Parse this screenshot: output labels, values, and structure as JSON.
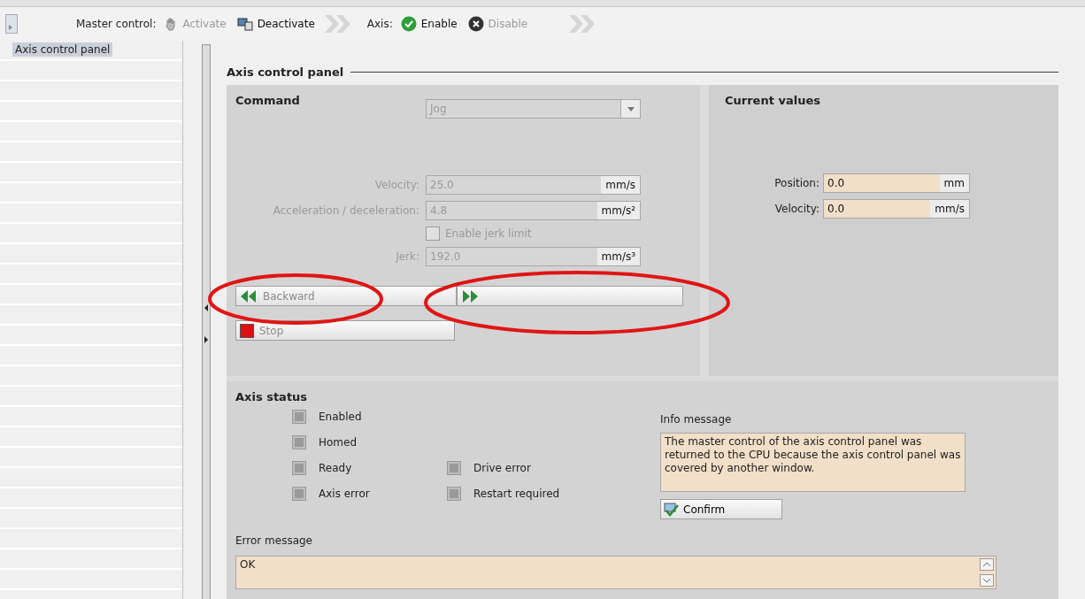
{
  "toolbar": {
    "master_control_label": "Master control:",
    "master_buttons": [
      {
        "kind": "activate",
        "label": "Activate",
        "disabled": true
      },
      {
        "kind": "deactivate",
        "label": "Deactivate",
        "disabled": false
      }
    ],
    "axis_label": "Axis:",
    "axis_buttons": [
      {
        "kind": "enable",
        "label": "Enable",
        "disabled": false
      },
      {
        "kind": "disable",
        "label": "Disable",
        "disabled": true
      }
    ]
  },
  "sidebar": {
    "items": [
      {
        "label": "Axis control panel",
        "selected": true
      }
    ]
  },
  "panel_title": "Axis control panel",
  "command": {
    "title": "Command",
    "disabled": true,
    "mode": "Jog",
    "rows": [
      {
        "kind": "field",
        "label": "Velocity:",
        "value": "25.0",
        "unit": "mm/s"
      },
      {
        "kind": "field",
        "label": "Acceleration / deceleration:",
        "value": "4.8",
        "unit": "mm/s²"
      },
      {
        "kind": "checkbox",
        "label": "Enable jerk limit",
        "checked": false
      },
      {
        "kind": "field",
        "label": "Jerk:",
        "value": "192.0",
        "unit": "mm/s³"
      }
    ],
    "buttons": [
      {
        "kind": "backward",
        "label": "Backward"
      },
      {
        "kind": "forward"
      },
      {
        "kind": "stop",
        "label": "Stop"
      }
    ]
  },
  "current_values": {
    "title": "Current values",
    "fields": [
      {
        "label": "Position:",
        "value": "0.0",
        "unit": "mm"
      },
      {
        "label": "Velocity:",
        "value": "0.0",
        "unit": "mm/s"
      }
    ]
  },
  "axis_status": {
    "title": "Axis status",
    "indicators_left": [
      {
        "label": "Enabled",
        "on": false
      },
      {
        "label": "Homed",
        "on": false
      },
      {
        "label": "Ready",
        "on": false
      },
      {
        "label": "Axis error",
        "on": false
      }
    ],
    "indicators_right": [
      {
        "label": "Drive error",
        "on": false
      },
      {
        "label": "Restart required",
        "on": false
      }
    ],
    "info_label": "Info message",
    "info_text": "The master control of the axis control panel was returned to the CPU because the axis control panel was covered by another window.",
    "confirm": "Confirm",
    "error_label": "Error message",
    "error_text": "OK"
  }
}
